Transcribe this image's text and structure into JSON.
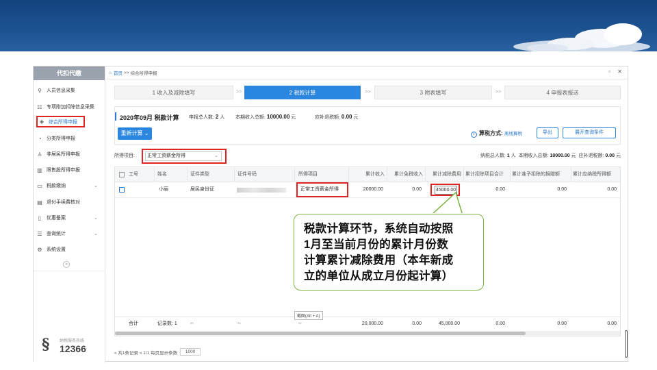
{
  "sidebar": {
    "title": "代扣代缴",
    "items": [
      {
        "label": "人员信息采集",
        "icon": "person-icon",
        "expand": ""
      },
      {
        "label": "专项附加扣除信息采集",
        "icon": "grid-icon",
        "expand": ""
      },
      {
        "label": "综合所得申报",
        "icon": "layers-icon",
        "expand": ""
      },
      {
        "label": "分类所得申报",
        "icon": "pie-icon",
        "expand": ""
      },
      {
        "label": "非居民所得申报",
        "icon": "user-icon",
        "expand": ""
      },
      {
        "label": "限售股所得申报",
        "icon": "bar-chart-icon",
        "expand": ""
      },
      {
        "label": "税款缴纳",
        "icon": "folder-icon",
        "expand": "⌄"
      },
      {
        "label": "退付手续费核对",
        "icon": "doc-icon",
        "expand": ""
      },
      {
        "label": "优惠备案",
        "icon": "file-icon",
        "expand": "⌄"
      },
      {
        "label": "查询统计",
        "icon": "search-list-icon",
        "expand": "⌄"
      },
      {
        "label": "系统设置",
        "icon": "gear-icon",
        "expand": ""
      }
    ],
    "collapse": "«",
    "hotline_label": "纳税服务热线",
    "hotline_number": "12366"
  },
  "breadcrumb": {
    "home": "首页",
    "separator": ">>",
    "current": "综合所得申报"
  },
  "window_controls": "▫ ✕",
  "steps": [
    {
      "label": "1 收入及减除填写",
      "active": false
    },
    {
      "label": "2 税款计算",
      "active": true
    },
    {
      "label": "3 附表填写",
      "active": false
    },
    {
      "label": "4 申报表报送",
      "active": false
    }
  ],
  "step_separator": ">>",
  "summary": {
    "period": "2020年09月 税款计算",
    "applicants_label": "申报总人数:",
    "applicants_value": "2",
    "applicants_unit": "人",
    "income_label": "本期收入总额:",
    "income_value": "10000.00",
    "income_unit": "元",
    "refund_label": "应补退税额:",
    "refund_value": "0.00",
    "refund_unit": "元",
    "recalc_button": "重新计算 ⌄",
    "tax_method_label": "算税方式:",
    "tax_method_value": "离线算税",
    "export_button": "导出",
    "expand_button": "展开查询条件"
  },
  "filter": {
    "label": "所得项目:",
    "selected": "正常工资薪金所得",
    "taxpayers_label": "纳税总人数:",
    "taxpayers_value": "1",
    "taxpayers_unit": "人",
    "income_label": "本期收入总额:",
    "income_value": "10000.00",
    "income_unit": "元",
    "refund_label": "应补退税额:",
    "refund_value": "0.00",
    "refund_unit": "元"
  },
  "table": {
    "headers": [
      "工号",
      "姓名",
      "证件类型",
      "证件号码",
      "所得项目",
      "累计收入",
      "累计免税收入",
      "累计减除费用",
      "累计扣除项目合计",
      "累计准予扣除的捐赠额",
      "累计应纳税所得额"
    ],
    "rows": [
      {
        "id": "",
        "name": "小丽",
        "id_type": "居民身份证",
        "id_number": "",
        "income_item": "正常工资薪金所得",
        "cum_income": "20000.00",
        "cum_exempt": "0.00",
        "cum_deduction": "45000.00",
        "cum_items": "0.00",
        "cum_donation": "0.00",
        "cum_taxable": "0.00"
      }
    ],
    "footer": {
      "label": "合计",
      "records": "记录数: 1",
      "dash1": "--",
      "dash2": "--",
      "dash3": "--",
      "cum_income": "20,000.00",
      "cum_exempt": "0.00",
      "cum_deduction": "45,000.00",
      "cum_items": "0.00",
      "cum_donation": "0.00",
      "cum_taxable": "0.00"
    }
  },
  "tooltip": "截图(Alt + A)",
  "pager": {
    "text": "« 共1条记录 » 1/1 每页显示条数",
    "page_size": "1000"
  },
  "callout": {
    "lines": [
      "税款计算环节，系统自动按照",
      "1月至当前月份的累计月份数",
      "计算累计减除费用（本年新成",
      "立的单位从成立月份起计算）"
    ]
  }
}
